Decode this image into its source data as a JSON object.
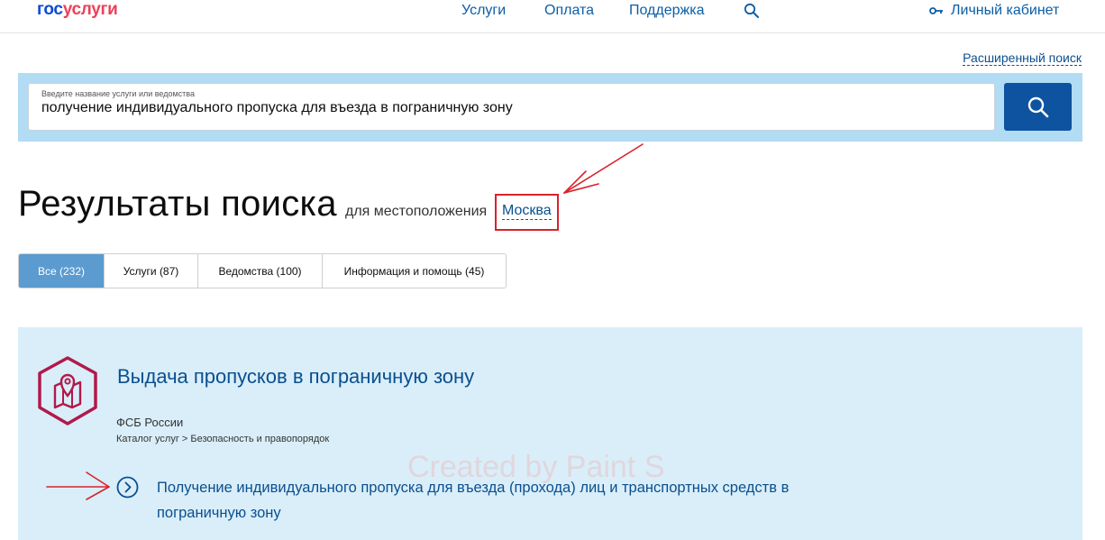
{
  "header": {
    "logo_part1": "гос",
    "logo_part2": "услуги",
    "nav": [
      "Услуги",
      "Оплата",
      "Поддержка"
    ],
    "cabinet_label": "Личный кабинет"
  },
  "advanced_search_label": "Расширенный поиск",
  "search": {
    "hint": "Введите название услуги или ведомства",
    "value": "получение индивидуального пропуска для въезда в пограничную зону"
  },
  "results": {
    "title": "Результаты поиска",
    "location_label": "для местоположения",
    "location_value": "Москва"
  },
  "tabs": [
    {
      "label": "Все (232)",
      "active": true
    },
    {
      "label": "Услуги (87)",
      "active": false
    },
    {
      "label": "Ведомства (100)",
      "active": false
    },
    {
      "label": "Информация и помощь (45)",
      "active": false
    }
  ],
  "card": {
    "title": "Выдача пропусков в пограничную зону",
    "org": "ФСБ России",
    "path": "Каталог услуг > Безопасность и правопорядок",
    "link_text": "Получение индивидуального пропуска для въезда (прохода) лиц и транспортных средств в пограничную зону"
  },
  "watermark": "Created by Paint S",
  "colors": {
    "brand_blue": "#0d4cd3",
    "brand_red": "#ee3f58",
    "link_blue": "#0b4f8e",
    "search_band": "#b2dbf4",
    "card_bg": "#d9eef9",
    "annotation_red": "#d9222a",
    "icon_crimson": "#b2194a"
  },
  "icons": {
    "nav_search": "search-icon",
    "cabinet": "key-icon",
    "search_button": "search-icon",
    "card": "map-pin-hexagon-icon",
    "link": "chevron-right-circle-icon"
  }
}
